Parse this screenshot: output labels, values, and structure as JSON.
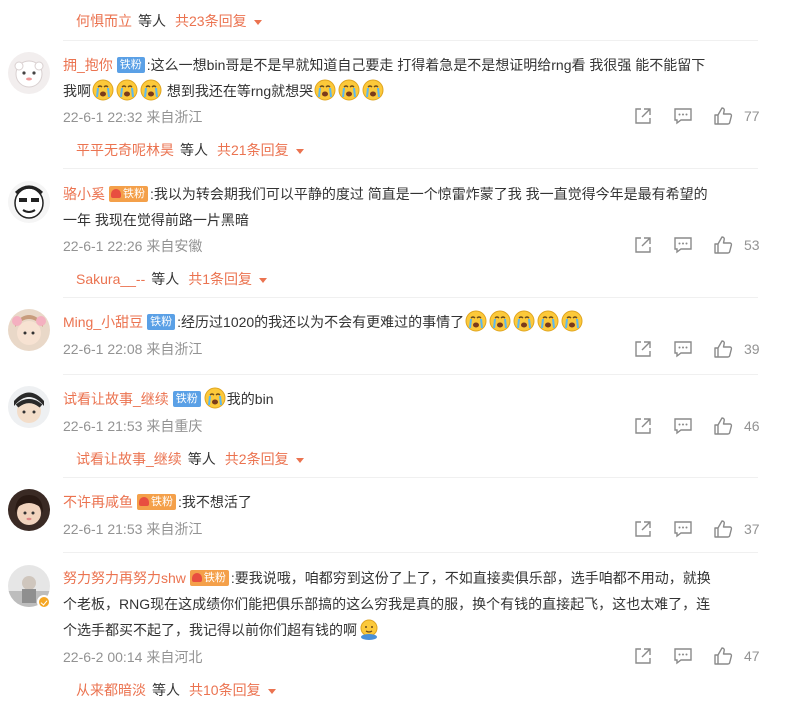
{
  "colors": {
    "accent": "#eb7350",
    "meta": "#939393",
    "text": "#333333",
    "fan_blue": "#5aa0e6",
    "fan_gold": "#f4a04a"
  },
  "icons": {
    "share": "share-icon",
    "comment": "comment-icon",
    "like": "thumbs-up-icon",
    "caret": "caret-down-icon",
    "emoji_cry": "crying-emoji",
    "emoji_hug": "hug-emoji"
  },
  "reply_common": {
    "middle": "等人"
  },
  "top_reply": {
    "name": "何惧而立",
    "count": "共23条回复"
  },
  "comments": [
    {
      "user": "拥_抱你",
      "badge": "铁粉",
      "line1": ":这么一想bin哥是不是早就知道自己要走 打得着急是不是想证明给rng看 我很强 能不能留下",
      "line2a": "我啊",
      "line2b": " 想到我还在等rng就想哭",
      "time": "22-6-1 22:32",
      "location": "来自浙江",
      "likes": "77",
      "reply": {
        "name": "平平无奇呢林昊",
        "count": "共21条回复"
      }
    },
    {
      "user": "骆小奚",
      "badge": "铁粉",
      "line1": ":我以为转会期我们可以平静的度过 简直是一个惊雷炸蒙了我 我一直觉得今年是最有希望的",
      "line2": "一年 我现在觉得前路一片黑暗",
      "time": "22-6-1 22:26",
      "location": "来自安徽",
      "likes": "53",
      "reply": {
        "name": "Sakura__--",
        "count": "共1条回复"
      }
    },
    {
      "user": "Ming_小甜豆",
      "badge": "铁粉",
      "line1": ":经历过1020的我还以为不会有更难过的事情了",
      "time": "22-6-1 22:08",
      "location": "来自浙江",
      "likes": "39"
    },
    {
      "user": "试看让故事_继续",
      "badge": "铁粉",
      "line1": "我的bin",
      "time": "22-6-1 21:53",
      "location": "来自重庆",
      "likes": "46",
      "reply": {
        "name": "试看让故事_继续",
        "count": "共2条回复"
      }
    },
    {
      "user": "不许再咸鱼",
      "badge": "铁粉",
      "line1": ":我不想活了",
      "time": "22-6-1 21:53",
      "location": "来自浙江",
      "likes": "37"
    },
    {
      "user": "努力努力再努力shw",
      "badge": "铁粉",
      "line1": ":要我说哦，咱都穷到这份了上了，不如直接卖俱乐部，选手咱都不用动，就换",
      "line2": "个老板，RNG现在这成绩你们能把俱乐部搞的这么穷我是真的服，换个有钱的直接起飞，这也太难了，连",
      "line3": "个选手都买不起了，我记得以前你们超有钱的啊",
      "time": "22-6-2 00:14",
      "location": "来自河北",
      "likes": "47",
      "reply": {
        "name": "从来都暗淡",
        "count": "共10条回复"
      }
    }
  ]
}
